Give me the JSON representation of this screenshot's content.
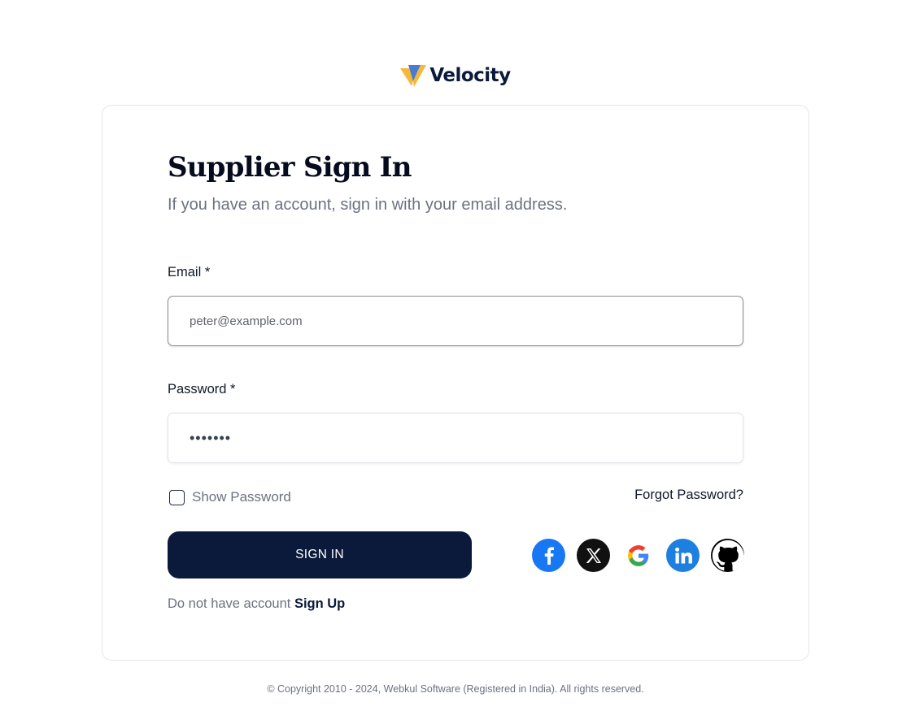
{
  "brand": {
    "name": "Velocity",
    "accent": "#f5b83d",
    "secondary": "#4a7bd0",
    "primary": "#0b1a3a"
  },
  "form": {
    "title": "Supplier Sign In",
    "subtitle": "If you have an account, sign in with your email address.",
    "email_label": "Email *",
    "email_placeholder": "peter@example.com",
    "password_label": "Password *",
    "password_value": "•••••••",
    "show_password_label": "Show Password",
    "forgot_password": "Forgot Password?",
    "signin_button": "SIGN IN",
    "signup_prompt": "Do not have account",
    "signup_link": "Sign Up"
  },
  "social_logins": [
    {
      "icon": "facebook-icon",
      "color": "#1877f2"
    },
    {
      "icon": "x-icon",
      "color": "#111111"
    },
    {
      "icon": "google-icon",
      "color": "#ffffff"
    },
    {
      "icon": "linkedin-icon",
      "color": "#1d7fe0"
    },
    {
      "icon": "github-icon",
      "color": "#000000"
    }
  ],
  "footer": {
    "copyright": "© Copyright 2010 - 2024, Webkul Software (Registered in India). All rights reserved."
  }
}
